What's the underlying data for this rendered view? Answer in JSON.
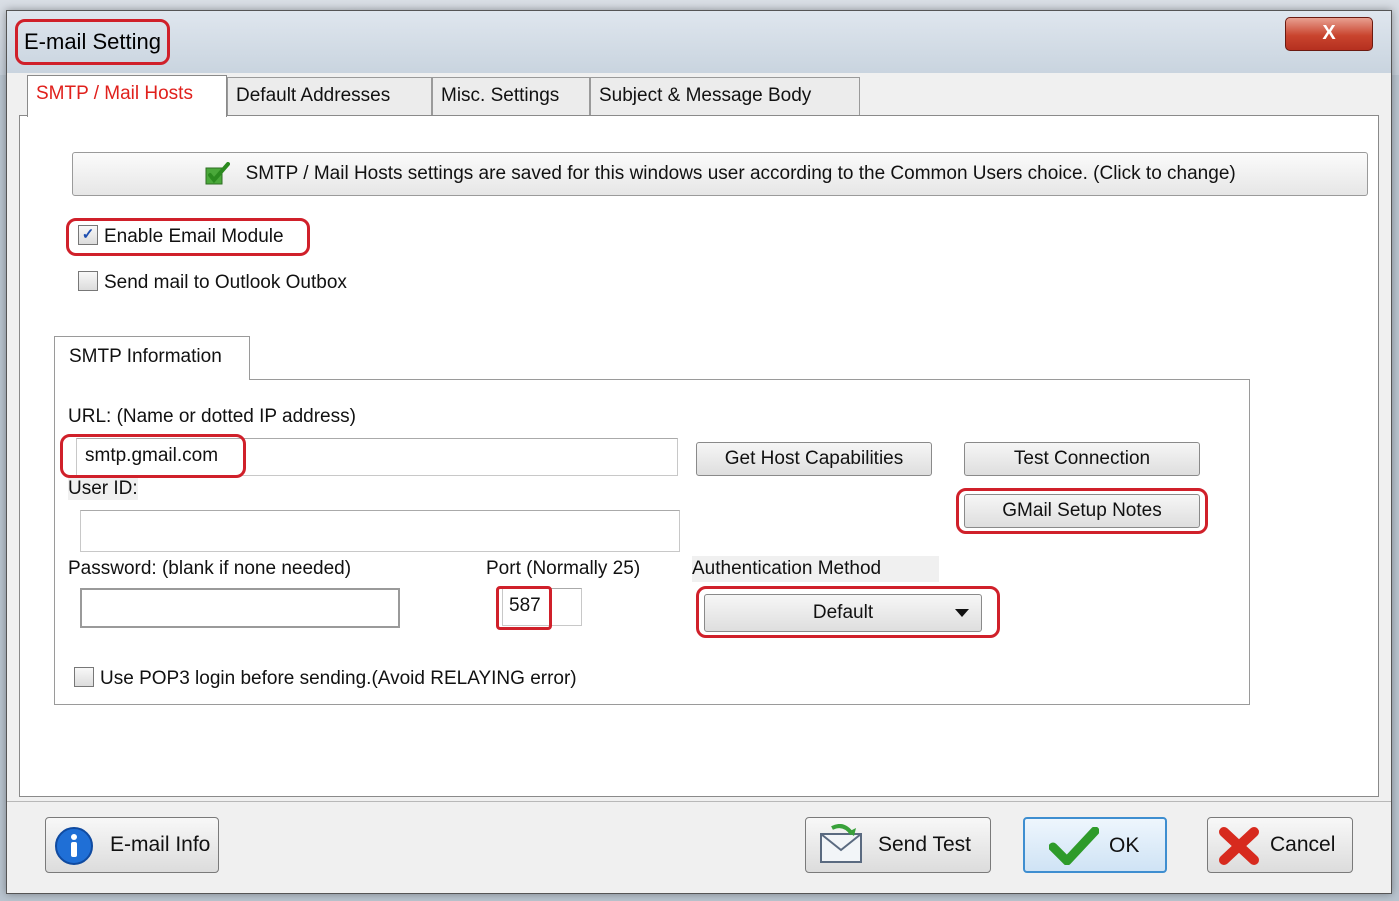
{
  "window": {
    "title": "E-mail Setting",
    "close_label": "X"
  },
  "tabs": [
    {
      "label": "SMTP / Mail Hosts",
      "active": true
    },
    {
      "label": "Default Addresses",
      "active": false
    },
    {
      "label": "Misc. Settings",
      "active": false
    },
    {
      "label": "Subject & Message Body",
      "active": false
    }
  ],
  "banner": {
    "icon": "check-icon",
    "text": "SMTP / Mail Hosts settings are saved for this windows user according to the Common Users choice.   (Click to change)"
  },
  "options": {
    "enable_email_module": {
      "label": "Enable Email Module",
      "checked": true
    },
    "send_to_outlook": {
      "label": "Send mail to Outlook Outbox",
      "checked": false
    }
  },
  "smtp": {
    "group_title": "SMTP Information",
    "url_label": "URL:  (Name or dotted IP address)",
    "url_value": "smtp.gmail.com",
    "userid_label": "User ID:",
    "userid_value": "",
    "password_label": "Password:  (blank if none needed)",
    "password_value": "",
    "port_label": "Port (Normally 25)",
    "port_value": "587",
    "auth_label": "Authentication Method",
    "auth_value": "Default",
    "get_host_button": "Get Host Capabilities",
    "test_connection_button": "Test Connection",
    "gmail_notes_button": "GMail Setup Notes",
    "pop3": {
      "label": "Use POP3 login before sending.(Avoid RELAYING error)",
      "checked": false
    }
  },
  "footer": {
    "email_info": "E-mail Info",
    "send_test": "Send Test",
    "ok": "OK",
    "cancel": "Cancel"
  },
  "colors": {
    "highlight_ring": "#d0202a",
    "active_tab_text": "#e0201c",
    "ok_border": "#3e8ed0"
  }
}
